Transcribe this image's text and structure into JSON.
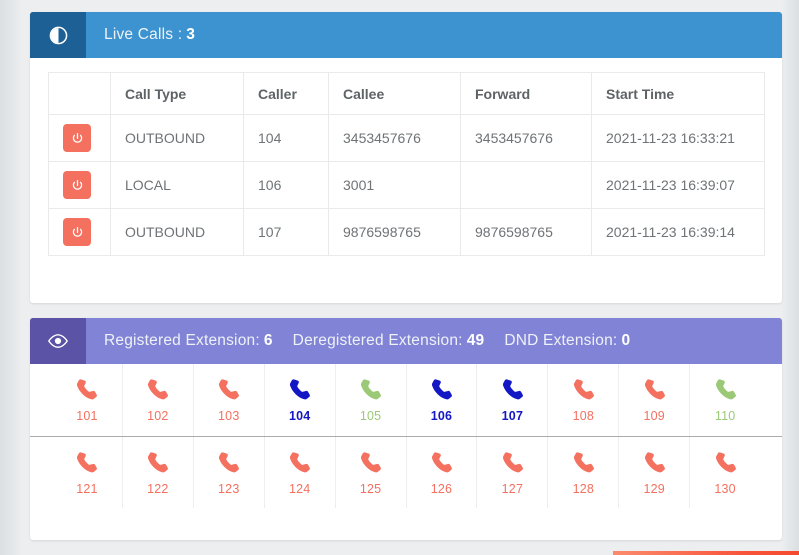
{
  "live_calls": {
    "icon": "contrast-circle-icon",
    "title_label": "Live Calls :",
    "count": "3",
    "accent_color": "#3d93d0",
    "icon_bg_color": "#1c6095",
    "columns": [
      "",
      "Call Type",
      "Caller",
      "Callee",
      "Forward",
      "Start Time"
    ],
    "hangup_icon": "power-icon",
    "hangup_color": "#f4705f",
    "rows": [
      {
        "action": "hangup",
        "call_type": "OUTBOUND",
        "caller": "104",
        "callee": "3453457676",
        "forward": "3453457676",
        "start_time": "2021-11-23 16:33:21"
      },
      {
        "action": "hangup",
        "call_type": "LOCAL",
        "caller": "106",
        "callee": "3001",
        "forward": "",
        "start_time": "2021-11-23 16:39:07"
      },
      {
        "action": "hangup",
        "call_type": "OUTBOUND",
        "caller": "107",
        "callee": "9876598765",
        "forward": "9876598765",
        "start_time": "2021-11-23 16:39:14"
      }
    ]
  },
  "extensions": {
    "icon": "eye-icon",
    "accent_color": "#8183d6",
    "icon_bg_color": "#5b53a6",
    "stats": [
      {
        "label": "Registered Extension:",
        "value": "6"
      },
      {
        "label": "Deregistered Extension:",
        "value": "49"
      },
      {
        "label": "DND Extension:",
        "value": "0"
      }
    ],
    "status_colors": {
      "free": "#f4705f",
      "busy": "#1417c4",
      "idle": "#9bc978"
    },
    "phone_icon": "phone-handset-icon",
    "rows": [
      [
        {
          "number": "101",
          "status": "free"
        },
        {
          "number": "102",
          "status": "free"
        },
        {
          "number": "103",
          "status": "free"
        },
        {
          "number": "104",
          "status": "busy"
        },
        {
          "number": "105",
          "status": "idle"
        },
        {
          "number": "106",
          "status": "busy"
        },
        {
          "number": "107",
          "status": "busy"
        },
        {
          "number": "108",
          "status": "free"
        },
        {
          "number": "109",
          "status": "free"
        },
        {
          "number": "110",
          "status": "idle"
        }
      ],
      [
        {
          "number": "121",
          "status": "free"
        },
        {
          "number": "122",
          "status": "free"
        },
        {
          "number": "123",
          "status": "free"
        },
        {
          "number": "124",
          "status": "free"
        },
        {
          "number": "125",
          "status": "free"
        },
        {
          "number": "126",
          "status": "free"
        },
        {
          "number": "127",
          "status": "free"
        },
        {
          "number": "128",
          "status": "free"
        },
        {
          "number": "129",
          "status": "free"
        },
        {
          "number": "130",
          "status": "free"
        }
      ]
    ]
  }
}
